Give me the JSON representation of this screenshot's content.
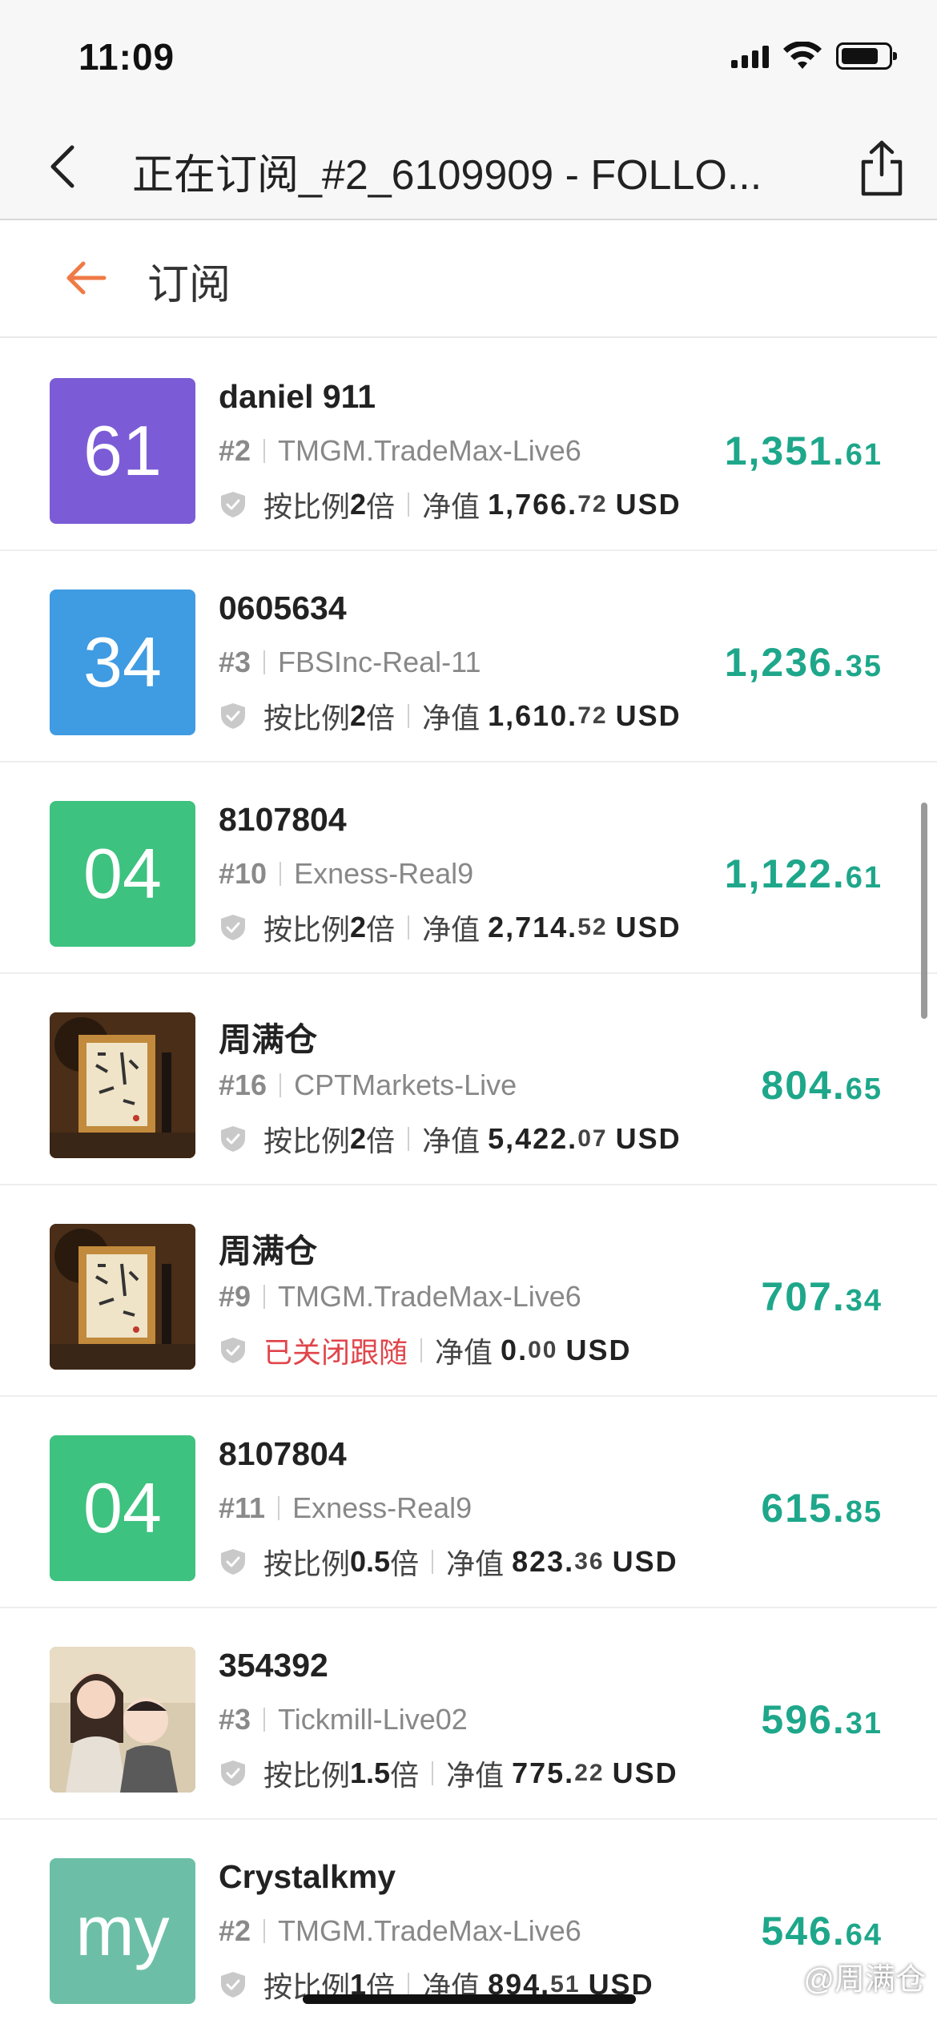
{
  "status_bar": {
    "time": "11:09"
  },
  "nav": {
    "title": "正在订阅_#2_6109909 - FOLLO..."
  },
  "header": {
    "title": "订阅"
  },
  "labels": {
    "ratio_prefix": "按比例",
    "ratio_suffix": "倍",
    "equity_label": "净值",
    "currency": "USD"
  },
  "colors": {
    "accent_green": "#1ea78a",
    "header_arrow": "#ef7a45",
    "closed_red": "#e0454a"
  },
  "items": [
    {
      "name": "daniel 911",
      "avatar_text": "61",
      "avatar_color": "#7b5cd6",
      "rank": "#2",
      "server": "TMGM.TradeMax-Live6",
      "ratio": "2",
      "status": "",
      "equity_int": "1,766.",
      "equity_dec": "72",
      "profit_int": "1,351.",
      "profit_dec": "61"
    },
    {
      "name": "0605634",
      "avatar_text": "34",
      "avatar_color": "#3f9be2",
      "rank": "#3",
      "server": "FBSInc-Real-11",
      "ratio": "2",
      "status": "",
      "equity_int": "1,610.",
      "equity_dec": "72",
      "profit_int": "1,236.",
      "profit_dec": "35"
    },
    {
      "name": "8107804",
      "avatar_text": "04",
      "avatar_color": "#3ec27f",
      "rank": "#10",
      "server": "Exness-Real9",
      "ratio": "2",
      "status": "",
      "equity_int": "2,714.",
      "equity_dec": "52",
      "profit_int": "1,122.",
      "profit_dec": "61"
    },
    {
      "name": "周满仓",
      "avatar_text": "",
      "avatar_color": "#6b4a2a",
      "rank": "#16",
      "server": "CPTMarkets-Live",
      "ratio": "2",
      "status": "",
      "equity_int": "5,422.",
      "equity_dec": "07",
      "profit_int": "804.",
      "profit_dec": "65"
    },
    {
      "name": "周满仓",
      "avatar_text": "",
      "avatar_color": "#6b4a2a",
      "rank": "#9",
      "server": "TMGM.TradeMax-Live6",
      "ratio": "",
      "status": "已关闭跟随",
      "equity_int": "0.",
      "equity_dec": "00",
      "profit_int": "707.",
      "profit_dec": "34"
    },
    {
      "name": "8107804",
      "avatar_text": "04",
      "avatar_color": "#3ec27f",
      "rank": "#11",
      "server": "Exness-Real9",
      "ratio": "0.5",
      "status": "",
      "equity_int": "823.",
      "equity_dec": "36",
      "profit_int": "615.",
      "profit_dec": "85"
    },
    {
      "name": "354392",
      "avatar_text": "",
      "avatar_color": "#8a9a7a",
      "rank": "#3",
      "server": "Tickmill-Live02",
      "ratio": "1.5",
      "status": "",
      "equity_int": "775.",
      "equity_dec": "22",
      "profit_int": "596.",
      "profit_dec": "31"
    },
    {
      "name": "Crystalkmy",
      "avatar_text": "my",
      "avatar_color": "#6cbfa6",
      "rank": "#2",
      "server": "TMGM.TradeMax-Live6",
      "ratio": "1",
      "status": "",
      "equity_int": "894.",
      "equity_dec": "51",
      "profit_int": "546.",
      "profit_dec": "64"
    }
  ],
  "watermark": "@周满仓"
}
